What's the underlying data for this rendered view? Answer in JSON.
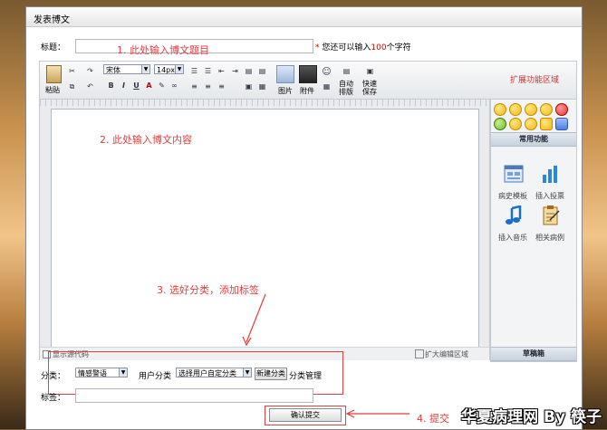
{
  "window": {
    "title": "发表博文"
  },
  "title_row": {
    "label": "标题：",
    "value": "",
    "asterisk": "*",
    "hint_pre": "您还可以输入",
    "hint_num": "100",
    "hint_post": "个字符"
  },
  "toolbar": {
    "paste_label": "粘贴",
    "font_family": "宋体",
    "font_size": "14px",
    "bold": "B",
    "italic": "I",
    "underline": "U",
    "strike": "A",
    "picture_label": "图片",
    "attach_label": "附件",
    "auto_layout_label": "自动排版",
    "quick_save_label": "快速保存",
    "extend_label": "扩展功能区域"
  },
  "editor": {
    "show_source_label": "显示源代码",
    "expand_label": "扩大编辑区域"
  },
  "side": {
    "common_title": "常用功能",
    "items": [
      {
        "label": "病史模板",
        "icon": "template-icon"
      },
      {
        "label": "插入投票",
        "icon": "vote-chart-icon"
      },
      {
        "label": "插入音乐",
        "icon": "music-note-icon"
      },
      {
        "label": "相关病例",
        "icon": "case-note-icon"
      }
    ],
    "drafts_label": "草稿箱"
  },
  "category_row": {
    "label": "分类：",
    "system_category": "情感警语",
    "user_category_label": "用户分类",
    "user_category_value": "选择用户自定分类",
    "new_button": "新建分类",
    "manage_link": "分类管理"
  },
  "tags_row": {
    "label": "标签：",
    "value": ""
  },
  "submit_button": "确认提交",
  "annotations": {
    "a1": "1. 此处输入博文题目",
    "a2": "2. 此处输入博文内容",
    "a3": "3. 选好分类，添加标签",
    "a4": "4. 提交"
  },
  "watermark": "华夏病理网 By 筷子",
  "colors": {
    "annotation": "#e23c3c",
    "hint_number": "#d40000",
    "frame_bg": "#ffffff"
  }
}
